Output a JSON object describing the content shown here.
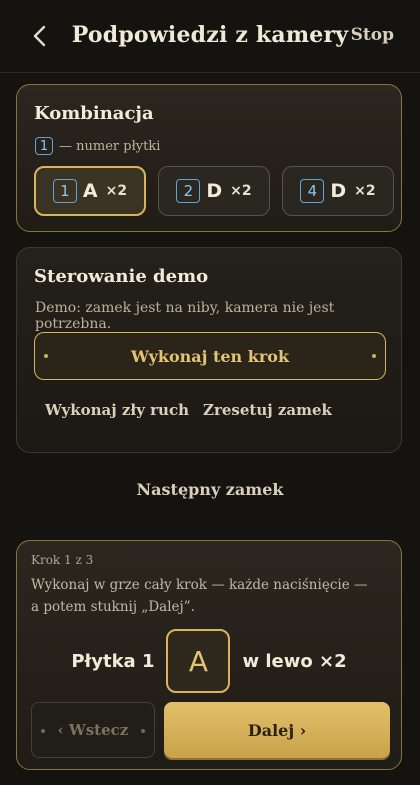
{
  "header": {
    "title": "Podpowiedzi z kamery",
    "stop_label": "Stop"
  },
  "combination": {
    "title": "Kombinacja",
    "legend_badge": "1",
    "legend_text": "— numer płytki",
    "items": [
      {
        "num": "1",
        "letter": "A",
        "count": "×2",
        "active": true
      },
      {
        "num": "2",
        "letter": "D",
        "count": "×2",
        "active": false
      },
      {
        "num": "4",
        "letter": "D",
        "count": "×2",
        "active": false
      }
    ]
  },
  "demo": {
    "title": "Sterowanie demo",
    "description": "Demo: zamek jest na niby, kamera nie jest potrzebna.",
    "do_step_label": "Wykonaj ten krok",
    "wrong_move_label": "Wykonaj zły ruch",
    "reset_label": "Zresetuj zamek"
  },
  "next_lock_label": "Następny zamek",
  "step": {
    "label": "Krok 1 z 3",
    "instruction_line1": "Wykonaj w grze cały krok — każde naciśnięcie —",
    "instruction_line2": "a potem stuknij „Dalej”.",
    "tile_prefix": "Płytka 1",
    "tile_letter": "A",
    "tile_suffix": "w lewo ×2",
    "back_label": "‹ Wstecz",
    "next_label": "Dalej ›"
  },
  "colors": {
    "accent_gold": "#d8b45c",
    "badge_blue": "#5fa6d6",
    "background": "#151310"
  }
}
